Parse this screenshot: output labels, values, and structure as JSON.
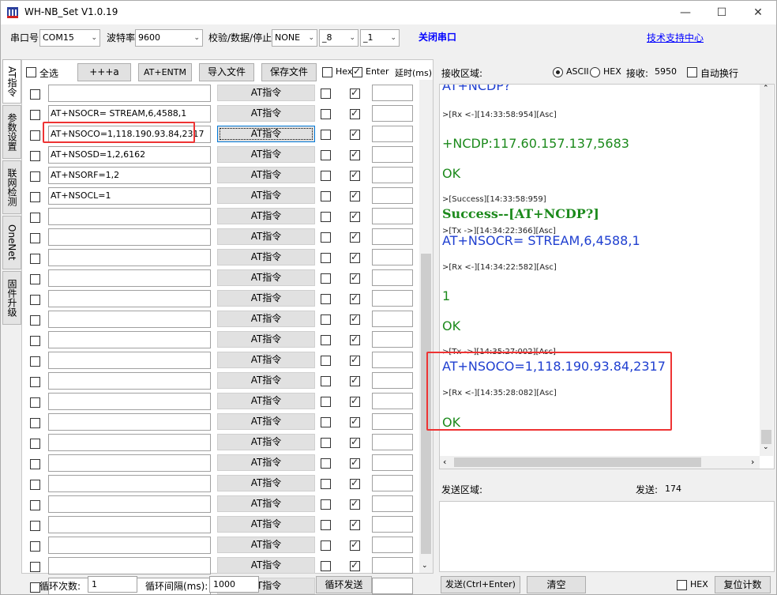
{
  "window": {
    "title": "WH-NB_Set V1.0.19",
    "min": "—",
    "max": "☐",
    "close": "✕"
  },
  "toolbar": {
    "port_label": "串口号",
    "port_value": "COM15",
    "baud_label": "波特率",
    "baud_value": "9600",
    "check_label": "校验/数据/停止",
    "parity_value": "NONE",
    "databits_value": "_8",
    "stopbits_value": "_1",
    "close_port": "关闭串口",
    "support": "技术支持中心"
  },
  "tabs": [
    "AT指令",
    "参数设置",
    "联网检测",
    "OneNet",
    "固件升级"
  ],
  "left": {
    "select_all": "全选",
    "btn_plus": "+++a",
    "btn_entm": "AT+ENTM",
    "import": "导入文件",
    "save": "保存文件",
    "hex": "Hex",
    "enter": "Enter",
    "delay": "延时(ms)",
    "commands": [
      "",
      "AT+NSOCR= STREAM,6,4588,1",
      "AT+NSOCO=1,118.190.93.84,2317",
      "AT+NSOSD=1,2,6162",
      "AT+NSORF=1,2",
      "AT+NSOCL=1",
      "",
      "",
      "",
      "",
      "",
      "",
      "",
      "",
      "",
      "",
      "",
      "",
      "",
      "",
      "",
      "",
      "",
      "",
      ""
    ],
    "at_label": "AT指令",
    "loop_count_label": "循环次数:",
    "loop_count": "1",
    "loop_interval_label": "循环间隔(ms):",
    "loop_interval": "1000",
    "loop_send": "循环发送"
  },
  "right": {
    "recv_label": "接收区域:",
    "ascii": "ASCII",
    "hex": "HEX",
    "recv_count_label": "接收:",
    "recv_count": "5950",
    "autowrap": "自动换行",
    "log": [
      {
        "cls": "blue",
        "text": "AT+NCDP?"
      },
      {
        "cls": "meta",
        "text": ">[Rx <-][14:33:58:954][Asc]"
      },
      {
        "cls": "green",
        "text": "+NCDP:117.60.157.137,5683"
      },
      {
        "cls": "green",
        "text": "OK"
      },
      {
        "cls": "meta",
        "text": ">[Success][14:33:58:959]"
      },
      {
        "cls": "succ",
        "text": "Success--[AT+NCDP?]"
      },
      {
        "cls": "meta",
        "text": ">[Tx ->][14:34:22:366][Asc]"
      },
      {
        "cls": "blue",
        "text": "AT+NSOCR= STREAM,6,4588,1"
      },
      {
        "cls": "meta",
        "text": ">[Rx <-][14:34:22:582][Asc]"
      },
      {
        "cls": "green",
        "text": "1"
      },
      {
        "cls": "green",
        "text": "OK"
      },
      {
        "cls": "meta",
        "text": ">[Tx ->][14:35:27:002][Asc]"
      },
      {
        "cls": "blue",
        "text": "AT+NSOCO=1,118.190.93.84,2317"
      },
      {
        "cls": "meta",
        "text": ">[Rx <-][14:35:28:082][Asc]"
      },
      {
        "cls": "green",
        "text": "OK"
      }
    ],
    "send_label": "发送区域:",
    "send_count_label": "发送:",
    "send_count": "174",
    "send_btn": "发送(Ctrl+Enter)",
    "clear_btn": "清空",
    "hex_label": "HEX",
    "reset_btn": "复位计数"
  }
}
